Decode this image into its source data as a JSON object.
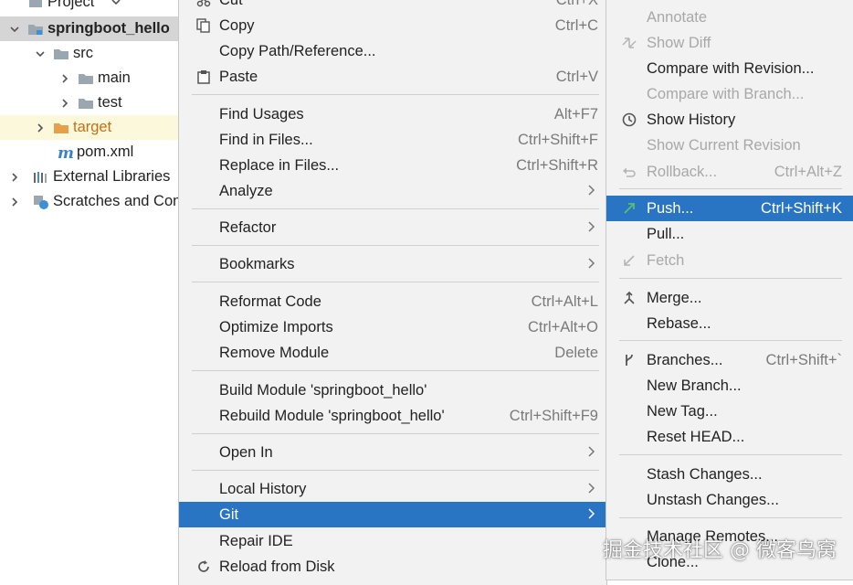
{
  "project": {
    "header": "Project",
    "root": "springboot_hello",
    "items": [
      {
        "label": "src"
      },
      {
        "label": "main"
      },
      {
        "label": "test"
      },
      {
        "label": "target"
      },
      {
        "label": "pom.xml"
      },
      {
        "label": "External Libraries"
      },
      {
        "label": "Scratches and Consoles"
      }
    ]
  },
  "context_menu": {
    "cut": {
      "label": "Cut",
      "shortcut": "Ctrl+X"
    },
    "copy": {
      "label": "Copy",
      "shortcut": "Ctrl+C"
    },
    "copy_path": {
      "label": "Copy Path/Reference..."
    },
    "paste": {
      "label": "Paste",
      "shortcut": "Ctrl+V"
    },
    "find_usages": {
      "label": "Find Usages",
      "shortcut": "Alt+F7"
    },
    "find_in_files": {
      "label": "Find in Files...",
      "shortcut": "Ctrl+Shift+F"
    },
    "replace_in_files": {
      "label": "Replace in Files...",
      "shortcut": "Ctrl+Shift+R"
    },
    "analyze": {
      "label": "Analyze"
    },
    "refactor": {
      "label": "Refactor"
    },
    "bookmarks": {
      "label": "Bookmarks"
    },
    "reformat_code": {
      "label": "Reformat Code",
      "shortcut": "Ctrl+Alt+L"
    },
    "optimize_imports": {
      "label": "Optimize Imports",
      "shortcut": "Ctrl+Alt+O"
    },
    "remove_module": {
      "label": "Remove Module",
      "shortcut": "Delete"
    },
    "build_module": {
      "label": "Build Module 'springboot_hello'"
    },
    "rebuild_module": {
      "label": "Rebuild Module 'springboot_hello'",
      "shortcut": "Ctrl+Shift+F9"
    },
    "open_in": {
      "label": "Open In"
    },
    "local_history": {
      "label": "Local History"
    },
    "git": {
      "label": "Git"
    },
    "repair_ide": {
      "label": "Repair IDE"
    },
    "reload_from_disk": {
      "label": "Reload from Disk"
    }
  },
  "git_menu": {
    "annotate": {
      "label": "Annotate"
    },
    "show_diff": {
      "label": "Show Diff"
    },
    "compare_revision": {
      "label": "Compare with Revision..."
    },
    "compare_branch": {
      "label": "Compare with Branch..."
    },
    "show_history": {
      "label": "Show History"
    },
    "show_current_revision": {
      "label": "Show Current Revision"
    },
    "rollback": {
      "label": "Rollback...",
      "shortcut": "Ctrl+Alt+Z"
    },
    "push": {
      "label": "Push...",
      "shortcut": "Ctrl+Shift+K"
    },
    "pull": {
      "label": "Pull..."
    },
    "fetch": {
      "label": "Fetch"
    },
    "merge": {
      "label": "Merge..."
    },
    "rebase": {
      "label": "Rebase..."
    },
    "branches": {
      "label": "Branches...",
      "shortcut": "Ctrl+Shift+`"
    },
    "new_branch": {
      "label": "New Branch..."
    },
    "new_tag": {
      "label": "New Tag..."
    },
    "reset_head": {
      "label": "Reset HEAD..."
    },
    "stash": {
      "label": "Stash Changes..."
    },
    "unstash": {
      "label": "Unstash Changes..."
    },
    "manage_remotes": {
      "label": "Manage Remotes..."
    },
    "clone": {
      "label": "Clone..."
    }
  },
  "watermark": "掘金技术社区 @ 微客鸟窝",
  "colors": {
    "highlight": "#2a75c3",
    "menu_bg": "#f2f2f2",
    "disabled": "#a8a8a8",
    "folder": "#9aa7b0",
    "excluded_folder": "#e6a04b",
    "excluded_row": "#fbf8dc"
  }
}
